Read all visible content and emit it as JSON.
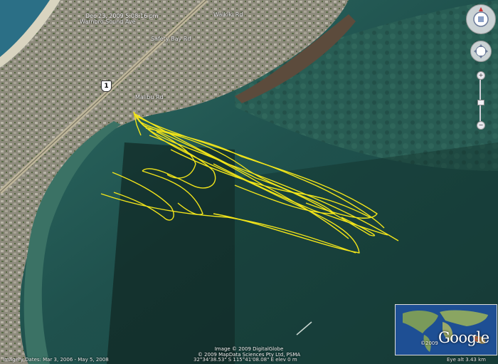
{
  "date_time_label": "Dec 23, 2009  5:08:16 pm",
  "road_labels": [
    "Warnbro Sound Ave",
    "Safety Bay Rd",
    "Waikiki Rd",
    "Malibu Rd"
  ],
  "highway_shield": "1",
  "credits": {
    "line1": "Image © 2009 DigitalGlobe",
    "line2": "© 2009 MapData Sciences Pty Ltd, PSMA"
  },
  "status_bar": {
    "imagery_dates": "Imagery Dates:  Mar 3, 2006 - May 5, 2008",
    "coordinates": "32°34'38.53\" S    115°41'08.08\" E   elev   0 m",
    "eye_alt": "Eye alt    3.43 km"
  },
  "overview": {
    "logo": "Google",
    "copyright": "©2009"
  },
  "controls": {
    "look_icon": "look-around-icon",
    "move_icon": "move-pan-icon",
    "zoom_in": "+",
    "zoom_out": "−"
  },
  "colors": {
    "gps_track": "#f2e51a",
    "water": "#1d4e4c",
    "land": "#8a8778"
  }
}
